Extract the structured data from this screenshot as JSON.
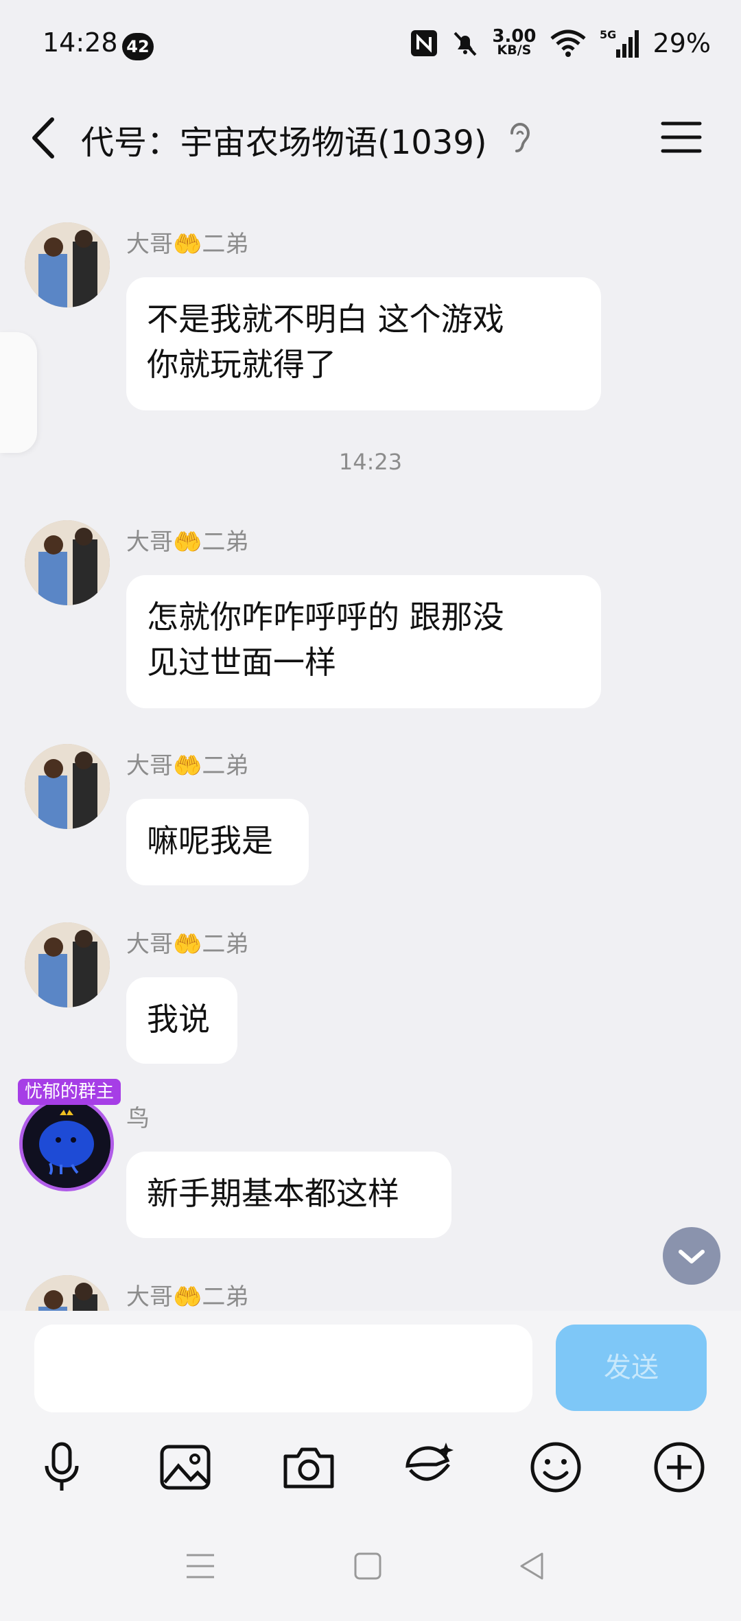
{
  "status": {
    "time": "14:28",
    "badge": "42",
    "speed_value": "3.00",
    "speed_unit": "KB/S",
    "network": "5G",
    "battery": "29%"
  },
  "header": {
    "title": "代号：宇宙农场物语(1039)"
  },
  "messages": [
    {
      "sender": "大哥🤲二弟",
      "text_lines": [
        "不是我就不明白 这个游戏",
        "你就玩就得了"
      ]
    },
    {
      "timestamp": "14:23"
    },
    {
      "sender": "大哥🤲二弟",
      "text_lines": [
        "怎就你咋咋呼呼的 跟那没",
        "见过世面一样"
      ]
    },
    {
      "sender": "大哥🤲二弟",
      "text": "嘛呢我是"
    },
    {
      "sender": "大哥🤲二弟",
      "text": "我说"
    },
    {
      "sender": "鸟",
      "badge": "忧郁的群主",
      "text": "新手期基本都这样"
    },
    {
      "sender": "大哥🤲二弟"
    }
  ],
  "composer": {
    "input_value": "",
    "send_label": "发送"
  },
  "toolbar": {
    "icons": [
      "microphone-icon",
      "image-icon",
      "camera-icon",
      "sticker-icon",
      "emoji-icon",
      "plus-icon"
    ]
  },
  "navbar": {
    "icons": [
      "menu-icon",
      "home-square-icon",
      "back-triangle-icon"
    ]
  }
}
